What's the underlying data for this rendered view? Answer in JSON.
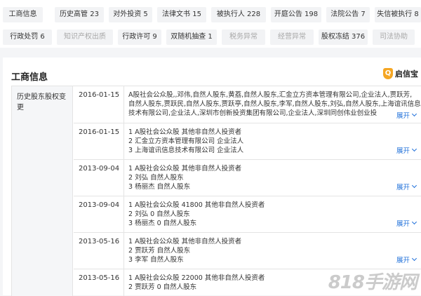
{
  "tabs_row1": [
    {
      "label": "工商信息",
      "disabled": false
    },
    {
      "label": "历史高管 23",
      "disabled": false
    },
    {
      "label": "对外投资 5",
      "disabled": false
    },
    {
      "label": "法律文书 15",
      "disabled": false
    },
    {
      "label": "被执行人 228",
      "disabled": false
    },
    {
      "label": "开庭公告 198",
      "disabled": false
    },
    {
      "label": "法院公告 7",
      "disabled": false
    },
    {
      "label": "失信被执行 8",
      "disabled": false
    }
  ],
  "tabs_row2": [
    {
      "label": "行政处罚 6",
      "disabled": false
    },
    {
      "label": "知识产权出质",
      "disabled": true
    },
    {
      "label": "行政许可 9",
      "disabled": false
    },
    {
      "label": "双随机抽查 1",
      "disabled": false
    },
    {
      "label": "税务异常",
      "disabled": true
    },
    {
      "label": "经营异常",
      "disabled": true
    },
    {
      "label": "股权冻结 376",
      "disabled": false
    },
    {
      "label": "司法协助",
      "disabled": true
    }
  ],
  "section": {
    "title": "工商信息"
  },
  "brand": {
    "icon": "shield-q-icon",
    "icon_char": "Q",
    "label": "启信宝"
  },
  "table": {
    "row_label": "历史股东股权变更",
    "rows": [
      {
        "date": "2016-01-15",
        "lines": [
          "A股社会公众股,,邓伟,自然人股东,黄荔,自然人股东,汇金立方资本管理有限公司,企业法人,贾跃芳,",
          "自然人股东,贾跃民,自然人股东,贾跃亭,自然人股东,李军,自然人股东,刘弘,自然人股东,上海谊讯信息",
          "技术有限公司,企业法人,深圳市创新投资集团有限公司,企业法人,深圳同创伟业创业投"
        ],
        "expand": "展开"
      },
      {
        "date": "2016-01-15",
        "lines": [
          "1 A股社会公众股 其他非自然人投资者",
          "2 汇金立方资本管理有限公司 企业法人",
          "3 上海谊讯信息技术有限公司 企业法人"
        ],
        "expand": "展开"
      },
      {
        "date": "2013-09-04",
        "lines": [
          "1 A股社会公众股 其他非自然人投资者",
          "2 刘弘 自然人股东",
          "3 杨丽杰 自然人股东"
        ],
        "expand": "展开"
      },
      {
        "date": "2013-09-04",
        "lines": [
          "1 A股社会公众股 41800 其他非自然人投资者",
          "2 刘弘 0 自然人股东",
          "3 杨丽杰 0 自然人股东"
        ],
        "expand": "展开"
      },
      {
        "date": "2013-05-16",
        "lines": [
          "1 A股社会公众股 其他非自然人投资者",
          "2 贾跃芳 自然人股东",
          "3 李军 自然人股东"
        ],
        "expand": "展开"
      },
      {
        "date": "2013-05-16",
        "lines": [
          "1 A股社会公众股 22000 其他非自然人投资者",
          "2 贾跃芳 0 自然人股东"
        ],
        "expand": ""
      }
    ]
  },
  "watermark": "818手游网",
  "colors": {
    "link": "#1e6fd9",
    "brand_icon": "#f5a623",
    "tab_bg": "#f2f3f5",
    "disabled_text": "#a8a8a8"
  }
}
